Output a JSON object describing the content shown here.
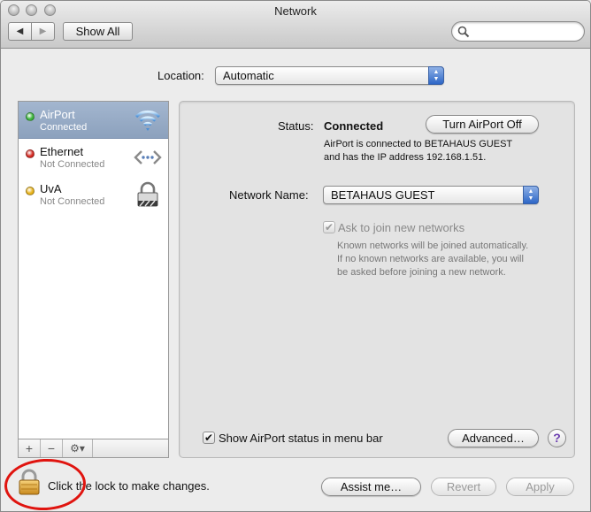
{
  "window": {
    "title": "Network"
  },
  "toolbar": {
    "back_glyph": "◀",
    "forward_glyph": "▶",
    "show_all_label": "Show All",
    "search_value": "",
    "search_placeholder": ""
  },
  "location": {
    "label": "Location:",
    "value": "Automatic"
  },
  "services": [
    {
      "name": "AirPort",
      "status": "Connected",
      "dot_color": "#3bb53b",
      "icon": "wifi-icon",
      "selected": true
    },
    {
      "name": "Ethernet",
      "status": "Not Connected",
      "dot_color": "#d42a22",
      "icon": "ethernet-icon",
      "selected": false
    },
    {
      "name": "UvA",
      "status": "Not Connected",
      "dot_color": "#e8b31a",
      "icon": "vpn-lock-icon",
      "selected": false
    }
  ],
  "sidebar_footer": {
    "add_glyph": "+",
    "remove_glyph": "−",
    "gear_glyph": "⚙▾"
  },
  "detail": {
    "status_label": "Status:",
    "status_value": "Connected",
    "turn_off_label": "Turn AirPort Off",
    "status_desc_line1": "AirPort is connected to BETAHAUS GUEST",
    "status_desc_line2": "and has the IP address 192.168.1.51.",
    "network_name_label": "Network Name:",
    "network_name_value": "BETAHAUS GUEST",
    "ask_join_label": "Ask to join new networks",
    "ask_join_checked": true,
    "ask_desc_line1": "Known networks will be joined automatically.",
    "ask_desc_line2": "If no known networks are available, you will",
    "ask_desc_line3": "be asked before joining a new network.",
    "show_status_label": "Show AirPort status in menu bar",
    "show_status_checked": true,
    "advanced_label": "Advanced…",
    "help_glyph": "?"
  },
  "bottom": {
    "lock_text": "Click the lock to make changes.",
    "assist_label": "Assist me…",
    "revert_label": "Revert",
    "apply_label": "Apply",
    "check_glyph": "✔"
  },
  "colors": {
    "selection": "#8ca1bd",
    "accent": "#2d66c7",
    "annotation_circle": "#e0140f"
  }
}
